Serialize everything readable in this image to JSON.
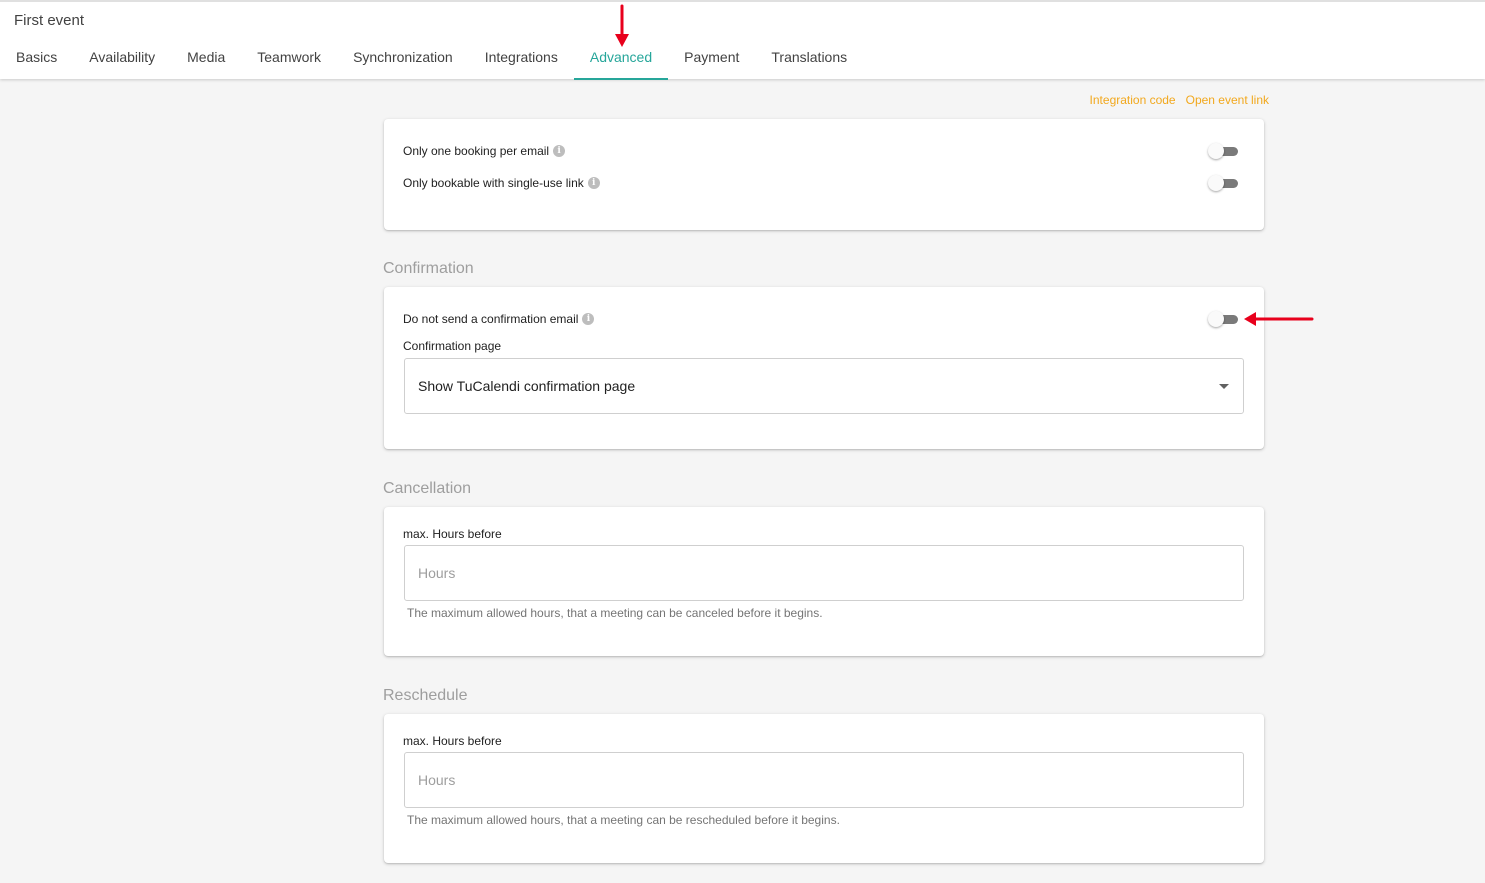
{
  "header": {
    "title": "First event"
  },
  "tabs": [
    {
      "label": "Basics"
    },
    {
      "label": "Availability"
    },
    {
      "label": "Media"
    },
    {
      "label": "Teamwork"
    },
    {
      "label": "Synchronization"
    },
    {
      "label": "Integrations"
    },
    {
      "label": "Advanced",
      "active": true
    },
    {
      "label": "Payment"
    },
    {
      "label": "Translations"
    }
  ],
  "links": {
    "integration_code": "Integration code",
    "open_event_link": "Open event link"
  },
  "booking": {
    "only_one_booking": {
      "label": "Only one booking per email",
      "enabled": false
    },
    "single_use_link": {
      "label": "Only bookable with single-use link",
      "enabled": false
    }
  },
  "confirmation": {
    "title": "Confirmation",
    "no_email": {
      "label": "Do not send a confirmation email",
      "enabled": false
    },
    "page_label": "Confirmation page",
    "page_value": "Show TuCalendi confirmation page"
  },
  "cancellation": {
    "title": "Cancellation",
    "field_label": "max. Hours before",
    "placeholder": "Hours",
    "hint": "The maximum allowed hours, that a meeting can be canceled before it begins."
  },
  "reschedule": {
    "title": "Reschedule",
    "field_label": "max. Hours before",
    "placeholder": "Hours",
    "hint": "The maximum allowed hours, that a meeting can be rescheduled before it begins."
  },
  "colors": {
    "accent": "#26a69a",
    "link": "#f2a81d",
    "annotation": "#e8001c"
  },
  "icons": {
    "info": "info-icon",
    "dropdown": "chevron-down-icon",
    "annotation": "red-arrow-icon"
  }
}
